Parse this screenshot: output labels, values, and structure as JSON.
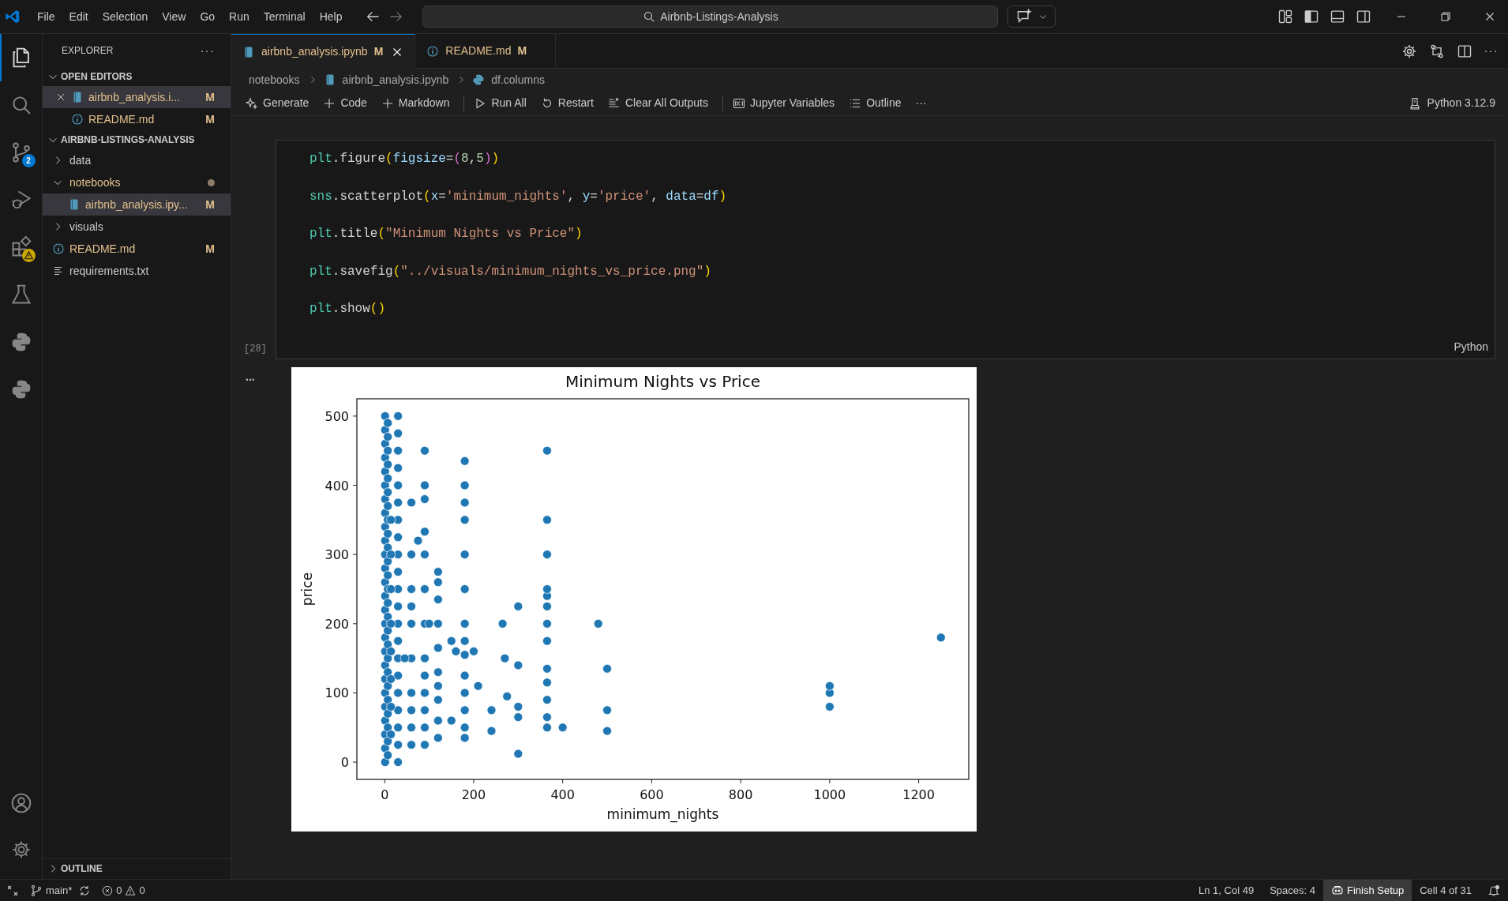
{
  "menu": [
    "File",
    "Edit",
    "Selection",
    "View",
    "Go",
    "Run",
    "Terminal",
    "Help"
  ],
  "command_center": {
    "text": "Airbnb-Listings-Analysis"
  },
  "activity_bar": [
    {
      "kind": "files",
      "selected": true
    },
    {
      "kind": "search",
      "selected": false
    },
    {
      "kind": "source-control",
      "selected": false,
      "badge": "2"
    },
    {
      "kind": "run-debug",
      "selected": false
    },
    {
      "kind": "extensions",
      "selected": false,
      "warning": true
    },
    {
      "kind": "testing",
      "selected": false
    },
    {
      "kind": "python",
      "selected": false
    },
    {
      "kind": "python",
      "selected": false
    }
  ],
  "sidebar": {
    "title": "EXPLORER",
    "actions": "···",
    "open_editors": {
      "title": "OPEN EDITORS",
      "expanded": true,
      "items": [
        {
          "label": "airbnb_analysis.i...",
          "badge": "M",
          "kind": "notebook",
          "selected": true
        },
        {
          "label": "README.md",
          "badge": "M",
          "kind": "info",
          "selected": false
        }
      ]
    },
    "project": {
      "title": "AIRBNB-LISTINGS-ANALYSIS",
      "expanded": true,
      "items": [
        {
          "label": "data",
          "kind": "folder",
          "expanded": false,
          "selected": false
        },
        {
          "label": "notebooks",
          "kind": "folder",
          "expanded": true,
          "selected": false,
          "modified_dot": true,
          "children": [
            {
              "label": "airbnb_analysis.ipy...",
              "kind": "notebook",
              "badge": "M",
              "selected": true
            }
          ]
        },
        {
          "label": "visuals",
          "kind": "folder",
          "expanded": false,
          "selected": false
        },
        {
          "label": "README.md",
          "kind": "info",
          "badge": "M",
          "selected": false
        },
        {
          "label": "requirements.txt",
          "kind": "text",
          "selected": false
        }
      ]
    },
    "outline": {
      "title": "OUTLINE",
      "expanded": false
    }
  },
  "tabs": [
    {
      "label": "airbnb_analysis.ipynb",
      "badge": "M",
      "kind": "notebook",
      "selected": true
    },
    {
      "label": "README.md",
      "badge": "M",
      "kind": "info",
      "selected": false
    }
  ],
  "tab_actions": "···",
  "breadcrumb": [
    {
      "label": "notebooks",
      "kind": "folder"
    },
    {
      "label": "airbnb_analysis.ipynb",
      "kind": "notebook"
    },
    {
      "label": "df.columns",
      "kind": "python"
    }
  ],
  "toolbar": [
    {
      "label": "Generate",
      "kind": "sparkle"
    },
    {
      "label": "Code",
      "kind": "plus"
    },
    {
      "label": "Markdown",
      "kind": "plus"
    },
    {
      "kind": "divider"
    },
    {
      "label": "Run All",
      "kind": "run"
    },
    {
      "label": "Restart",
      "kind": "restart"
    },
    {
      "label": "Clear All Outputs",
      "kind": "clear"
    },
    {
      "kind": "divider"
    },
    {
      "label": "Jupyter Variables",
      "kind": "variables"
    },
    {
      "label": "Outline",
      "kind": "list"
    },
    {
      "label": "···",
      "kind": "more"
    }
  ],
  "kernel": "Python 3.12.9",
  "cell": {
    "execution_count": "[28]",
    "language": "Python",
    "lines": [
      [
        {
          "kind": "module",
          "text": "plt"
        },
        {
          "kind": "plain",
          "text": ".figure"
        },
        {
          "kind": "paren1",
          "text": "("
        },
        {
          "kind": "param",
          "text": "figsize"
        },
        {
          "kind": "plain",
          "text": "="
        },
        {
          "kind": "paren2",
          "text": "("
        },
        {
          "kind": "number",
          "text": "8"
        },
        {
          "kind": "plain",
          "text": ","
        },
        {
          "kind": "number",
          "text": "5"
        },
        {
          "kind": "paren2",
          "text": ")"
        },
        {
          "kind": "paren1",
          "text": ")"
        }
      ],
      [
        {
          "kind": "module",
          "text": "sns"
        },
        {
          "kind": "plain",
          "text": ".scatterplot"
        },
        {
          "kind": "paren1",
          "text": "("
        },
        {
          "kind": "param",
          "text": "x"
        },
        {
          "kind": "plain",
          "text": "="
        },
        {
          "kind": "string",
          "text": "'minimum_nights'"
        },
        {
          "kind": "plain",
          "text": ", "
        },
        {
          "kind": "param",
          "text": "y"
        },
        {
          "kind": "plain",
          "text": "="
        },
        {
          "kind": "string",
          "text": "'price'"
        },
        {
          "kind": "plain",
          "text": ", "
        },
        {
          "kind": "param",
          "text": "data"
        },
        {
          "kind": "plain",
          "text": "="
        },
        {
          "kind": "param",
          "text": "df"
        },
        {
          "kind": "paren1",
          "text": ")"
        }
      ],
      [
        {
          "kind": "module",
          "text": "plt"
        },
        {
          "kind": "plain",
          "text": ".title"
        },
        {
          "kind": "paren1",
          "text": "("
        },
        {
          "kind": "string",
          "text": "\"Minimum Nights vs Price\""
        },
        {
          "kind": "paren1",
          "text": ")"
        }
      ],
      [
        {
          "kind": "module",
          "text": "plt"
        },
        {
          "kind": "plain",
          "text": ".savefig"
        },
        {
          "kind": "paren1",
          "text": "("
        },
        {
          "kind": "string",
          "text": "\"../visuals/minimum_nights_vs_price.png\""
        },
        {
          "kind": "paren1",
          "text": ")"
        }
      ],
      [
        {
          "kind": "module",
          "text": "plt"
        },
        {
          "kind": "plain",
          "text": ".show"
        },
        {
          "kind": "paren1",
          "text": "()"
        }
      ]
    ]
  },
  "output": {
    "marker": "...",
    "chart_data": {
      "type": "scatter",
      "title": "Minimum Nights vs Price",
      "xlabel": "minimum_nights",
      "ylabel": "price",
      "x": [
        1,
        1,
        1,
        1,
        1,
        1,
        1,
        1,
        1,
        1,
        1,
        1,
        1,
        1,
        1,
        1,
        1,
        1,
        1,
        1,
        1,
        1,
        1,
        1,
        1,
        1,
        7,
        7,
        7,
        7,
        7,
        7,
        7,
        7,
        7,
        7,
        7,
        7,
        7,
        7,
        7,
        7,
        7,
        7,
        7,
        7,
        7,
        7,
        7,
        7,
        7,
        30,
        30,
        30,
        30,
        30,
        30,
        30,
        30,
        30,
        30,
        30,
        30,
        30,
        30,
        30,
        30,
        30,
        30,
        30,
        30,
        30,
        14,
        14,
        14,
        14,
        14,
        14,
        14,
        14,
        60,
        60,
        60,
        60,
        60,
        60,
        60,
        60,
        60,
        60,
        90,
        90,
        90,
        90,
        90,
        90,
        90,
        90,
        90,
        90,
        90,
        90,
        90,
        120,
        120,
        120,
        120,
        120,
        120,
        120,
        120,
        120,
        120,
        180,
        180,
        180,
        180,
        180,
        180,
        180,
        180,
        180,
        180,
        180,
        180,
        180,
        180,
        365,
        365,
        365,
        365,
        365,
        365,
        365,
        365,
        365,
        365,
        365,
        365,
        365,
        45,
        75,
        100,
        150,
        150,
        160,
        200,
        210,
        240,
        240,
        265,
        270,
        275,
        300,
        300,
        300,
        300,
        300,
        400,
        480,
        500,
        500,
        500,
        1000,
        1000,
        1000,
        1250
      ],
      "series": [
        {
          "color": "#1f77b4",
          "values": [
            0,
            20,
            40,
            60,
            80,
            100,
            120,
            140,
            160,
            180,
            200,
            220,
            240,
            260,
            280,
            300,
            320,
            340,
            360,
            380,
            400,
            420,
            440,
            460,
            480,
            500,
            10,
            30,
            50,
            70,
            90,
            110,
            130,
            150,
            170,
            190,
            210,
            230,
            250,
            270,
            290,
            310,
            330,
            350,
            370,
            390,
            410,
            430,
            450,
            470,
            490,
            0,
            25,
            50,
            75,
            100,
            125,
            150,
            175,
            200,
            225,
            250,
            275,
            300,
            325,
            350,
            375,
            400,
            425,
            450,
            475,
            500,
            40,
            80,
            120,
            160,
            200,
            250,
            300,
            350,
            25,
            50,
            75,
            100,
            150,
            200,
            225,
            250,
            300,
            375,
            25,
            50,
            75,
            100,
            125,
            150,
            200,
            250,
            300,
            333,
            380,
            400,
            450,
            35,
            60,
            90,
            110,
            130,
            165,
            200,
            235,
            260,
            275,
            35,
            50,
            75,
            100,
            125,
            155,
            175,
            200,
            250,
            300,
            350,
            375,
            400,
            435,
            50,
            65,
            90,
            115,
            135,
            175,
            200,
            225,
            240,
            250,
            300,
            350,
            450,
            150,
            320,
            200,
            60,
            175,
            160,
            160,
            110,
            45,
            75,
            200,
            150,
            95,
            12,
            65,
            80,
            140,
            225,
            50,
            200,
            45,
            75,
            135,
            80,
            100,
            110,
            180
          ]
        }
      ],
      "xlim": [
        -62.5,
        1312.5
      ],
      "ylim": [
        -25,
        525
      ],
      "xticks": [
        0,
        200,
        400,
        600,
        800,
        1000,
        1200
      ],
      "yticks": [
        0,
        100,
        200,
        300,
        400,
        500
      ]
    }
  },
  "status_bar": {
    "branch": "main*",
    "errors": "0",
    "warnings": "0",
    "right": [
      {
        "label": "Ln 1, Col 49",
        "highlight": false
      },
      {
        "label": "Spaces: 4",
        "highlight": false
      },
      {
        "label": "Finish Setup",
        "highlight": true,
        "kind": "copilot"
      },
      {
        "label": "Cell 4 of 31",
        "highlight": false
      }
    ]
  }
}
